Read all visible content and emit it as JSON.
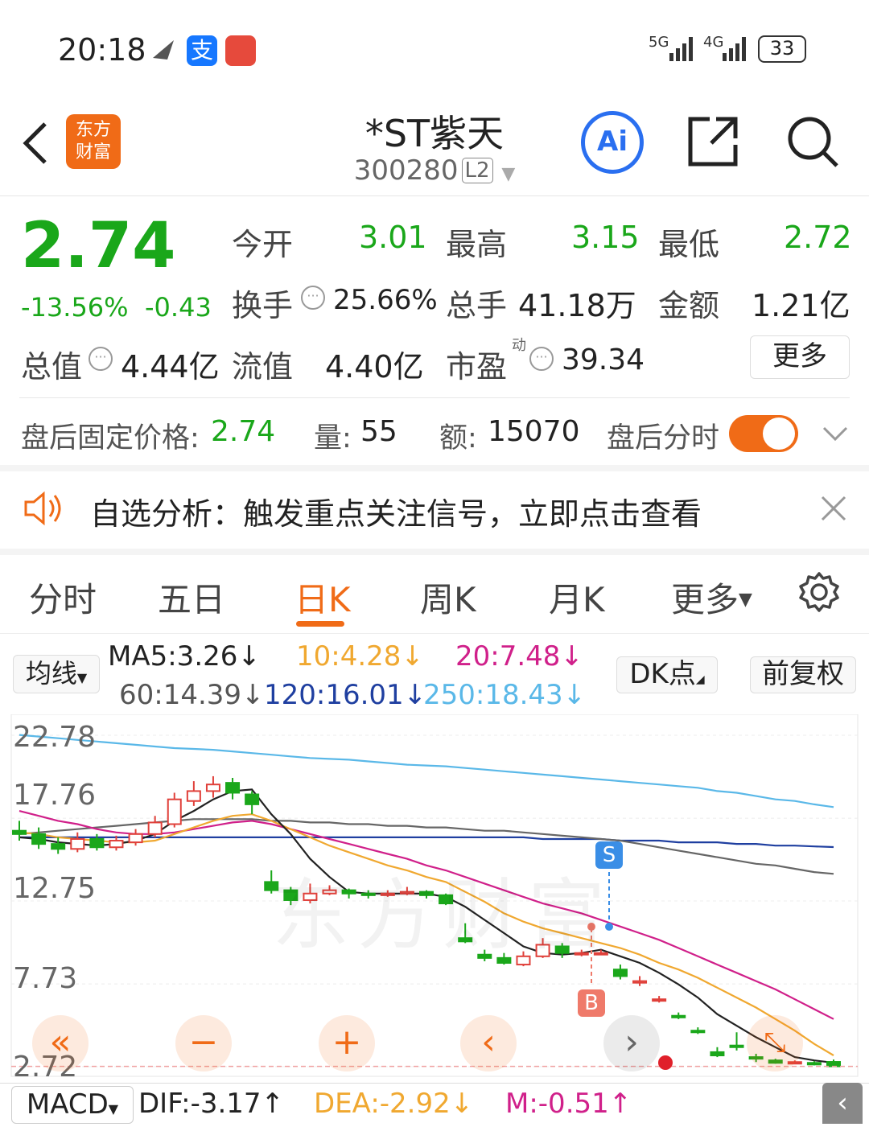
{
  "status": {
    "time": "20:18",
    "net1": "5G",
    "net2": "4G",
    "battery": "33"
  },
  "header": {
    "logo_line1": "东方",
    "logo_line2": "财富",
    "title": "*ST紫天",
    "code": "300280",
    "level": "L2",
    "ai_label": "Ai"
  },
  "quote": {
    "price": "2.74",
    "change_pct": "-13.56%",
    "change": "-0.43",
    "open_label": "今开",
    "open": "3.01",
    "high_label": "最高",
    "high": "3.15",
    "low_label": "最低",
    "low": "2.72",
    "turnover_label": "换手",
    "turnover": "25.66%",
    "volume_label": "总手",
    "volume": "41.18万",
    "amount_label": "金额",
    "amount": "1.21亿",
    "mcap_label": "总值",
    "mcap": "4.44亿",
    "float_label": "流值",
    "float": "4.40亿",
    "pe_label": "市盈",
    "pe_sup": "动",
    "pe": "39.34",
    "more": "更多"
  },
  "afterhours": {
    "price_label": "盘后固定价格:",
    "price": "2.74",
    "vol_label": "量:",
    "vol": "55",
    "amt_label": "额:",
    "amt": "15070",
    "toggle_label": "盘后分时"
  },
  "notice": {
    "text": "自选分析：触发重点关注信号，立即点击查看"
  },
  "tabs": [
    "分时",
    "五日",
    "日K",
    "周K",
    "月K",
    "更多"
  ],
  "active_tab": "日K",
  "ma": {
    "selector": "均线",
    "ma5": "MA5:3.26↓",
    "ma10": "10:4.28↓",
    "ma20": "20:7.48↓",
    "ma60": "60:14.39↓",
    "ma120": "120:16.01↓",
    "ma250": "250:18.43↓",
    "dk": "DK点",
    "adjust": "前复权"
  },
  "colors": {
    "up": "#e0403a",
    "down": "#1aa71a",
    "accent": "#f06b17",
    "ma5": "#222222",
    "ma10": "#f0a830",
    "ma20": "#d0208a",
    "ma60": "#666666",
    "ma120": "#1f3fa0",
    "ma250": "#5ab8e8"
  },
  "chart": {
    "y_ticks": [
      "22.78",
      "17.76",
      "12.75",
      "7.73",
      "2.72"
    ],
    "watermark": "东方财富",
    "signal_s": "S",
    "signal_b": "B"
  },
  "macd": {
    "label": "MACD",
    "dif": "DIF:-3.17↑",
    "dea": "DEA:-2.92↓",
    "m": "M:-0.51↑"
  },
  "chart_data": {
    "type": "candlestick",
    "ylim": [
      2.72,
      22.78
    ],
    "y_ticks": [
      22.78,
      17.76,
      12.75,
      7.73,
      2.72
    ],
    "candles": [
      [
        17.0,
        16.8,
        17.6,
        16.4
      ],
      [
        16.8,
        16.2,
        17.2,
        15.9
      ],
      [
        16.2,
        15.9,
        16.6,
        15.6
      ],
      [
        15.9,
        16.5,
        16.9,
        15.7
      ],
      [
        16.5,
        16.0,
        16.8,
        15.8
      ],
      [
        16.0,
        16.4,
        16.7,
        15.8
      ],
      [
        16.3,
        16.8,
        17.1,
        16.1
      ],
      [
        16.8,
        17.5,
        17.9,
        16.6
      ],
      [
        17.4,
        18.9,
        19.3,
        17.2
      ],
      [
        18.8,
        19.4,
        20.0,
        18.5
      ],
      [
        19.4,
        19.8,
        20.3,
        19.0
      ],
      [
        19.9,
        19.3,
        20.2,
        18.9
      ],
      [
        19.2,
        18.6,
        19.4,
        18.0
      ],
      [
        13.9,
        13.4,
        14.6,
        13.2
      ],
      [
        13.4,
        12.8,
        13.6,
        12.5
      ],
      [
        12.8,
        13.2,
        13.8,
        12.6
      ],
      [
        13.2,
        13.4,
        13.7,
        13.1
      ],
      [
        13.4,
        13.2,
        13.5,
        12.9
      ],
      [
        13.2,
        13.1,
        13.4,
        12.9
      ],
      [
        13.1,
        13.2,
        13.4,
        13.0
      ],
      [
        13.2,
        13.3,
        13.6,
        13.1
      ],
      [
        13.3,
        13.1,
        13.4,
        12.9
      ],
      [
        13.1,
        12.6,
        13.2,
        12.5
      ],
      [
        10.5,
        10.3,
        11.4,
        10.2
      ],
      [
        9.5,
        9.3,
        9.8,
        9.1
      ],
      [
        9.3,
        9.0,
        9.6,
        8.9
      ],
      [
        8.9,
        9.4,
        9.7,
        8.8
      ],
      [
        9.4,
        10.1,
        10.5,
        9.3
      ],
      [
        10.0,
        9.6,
        10.2,
        9.3
      ],
      [
        9.6,
        9.6,
        9.8,
        9.4
      ],
      [
        9.6,
        9.6,
        9.8,
        9.5
      ],
      [
        8.6,
        8.2,
        8.9,
        8.0
      ],
      [
        7.8,
        7.9,
        8.2,
        7.6
      ],
      [
        6.8,
        6.8,
        7.0,
        6.6
      ],
      [
        5.8,
        5.7,
        6.0,
        5.6
      ],
      [
        4.9,
        4.8,
        5.1,
        4.7
      ],
      [
        3.6,
        3.4,
        3.9,
        3.3
      ],
      [
        4.0,
        3.9,
        4.8,
        3.7
      ],
      [
        3.3,
        3.2,
        3.5,
        3.0
      ],
      [
        3.1,
        2.95,
        3.2,
        2.9
      ],
      [
        2.95,
        3.0,
        3.1,
        2.9
      ],
      [
        2.95,
        2.9,
        3.05,
        2.8
      ],
      [
        3.01,
        2.74,
        3.15,
        2.72
      ]
    ],
    "ma5": [
      16.6,
      16.5,
      16.3,
      16.2,
      16.1,
      16.2,
      16.4,
      16.8,
      17.6,
      18.2,
      18.9,
      19.4,
      19.5,
      18.0,
      16.8,
      15.3,
      14.2,
      13.3,
      13.2,
      13.2,
      13.2,
      13.2,
      13.0,
      12.4,
      11.6,
      10.8,
      10.0,
      9.6,
      9.5,
      9.6,
      9.8,
      9.4,
      9.0,
      8.4,
      7.7,
      6.9,
      5.9,
      5.2,
      4.5,
      3.9,
      3.3,
      3.1,
      2.96
    ],
    "ma10": [
      16.9,
      16.8,
      16.6,
      16.5,
      16.4,
      16.3,
      16.3,
      16.4,
      16.8,
      17.2,
      17.6,
      17.9,
      18.0,
      17.6,
      17.1,
      16.6,
      16.1,
      15.7,
      15.3,
      14.9,
      14.6,
      14.2,
      13.9,
      13.3,
      12.7,
      12.0,
      11.5,
      11.1,
      10.8,
      10.5,
      10.2,
      9.9,
      9.5,
      9.0,
      8.6,
      8.1,
      7.5,
      6.9,
      6.3,
      5.6,
      4.9,
      4.1,
      3.4
    ],
    "ma20": [
      18.2,
      17.9,
      17.6,
      17.4,
      17.1,
      16.9,
      16.8,
      16.8,
      16.9,
      17.1,
      17.3,
      17.5,
      17.6,
      17.4,
      17.1,
      16.8,
      16.5,
      16.2,
      15.9,
      15.6,
      15.3,
      14.9,
      14.6,
      14.2,
      13.8,
      13.4,
      13.0,
      12.6,
      12.3,
      12.0,
      11.6,
      11.2,
      10.8,
      10.4,
      9.9,
      9.4,
      8.9,
      8.4,
      7.9,
      7.4,
      6.8,
      6.2,
      5.6
    ],
    "ma60": [
      16.8,
      16.9,
      17.0,
      17.1,
      17.2,
      17.3,
      17.4,
      17.5,
      17.6,
      17.7,
      17.7,
      17.7,
      17.7,
      17.6,
      17.6,
      17.5,
      17.5,
      17.4,
      17.4,
      17.3,
      17.3,
      17.2,
      17.2,
      17.1,
      17.0,
      17.0,
      16.9,
      16.8,
      16.7,
      16.6,
      16.5,
      16.4,
      16.2,
      16.0,
      15.8,
      15.6,
      15.4,
      15.2,
      15.0,
      14.9,
      14.7,
      14.5,
      14.39
    ],
    "ma120": [
      16.6,
      16.6,
      16.6,
      16.6,
      16.6,
      16.6,
      16.6,
      16.6,
      16.6,
      16.6,
      16.6,
      16.6,
      16.6,
      16.6,
      16.6,
      16.6,
      16.6,
      16.6,
      16.6,
      16.6,
      16.6,
      16.6,
      16.6,
      16.6,
      16.6,
      16.6,
      16.6,
      16.5,
      16.5,
      16.5,
      16.5,
      16.4,
      16.4,
      16.4,
      16.3,
      16.3,
      16.3,
      16.2,
      16.2,
      16.1,
      16.1,
      16.05,
      16.01
    ],
    "ma250": [
      22.8,
      22.7,
      22.6,
      22.5,
      22.4,
      22.3,
      22.2,
      22.1,
      22.0,
      21.95,
      21.9,
      21.8,
      21.7,
      21.6,
      21.5,
      21.4,
      21.35,
      21.3,
      21.2,
      21.1,
      21.0,
      20.95,
      20.9,
      20.8,
      20.7,
      20.6,
      20.5,
      20.4,
      20.3,
      20.2,
      20.1,
      20.0,
      19.9,
      19.8,
      19.7,
      19.6,
      19.4,
      19.3,
      19.1,
      18.9,
      18.8,
      18.6,
      18.43
    ]
  }
}
